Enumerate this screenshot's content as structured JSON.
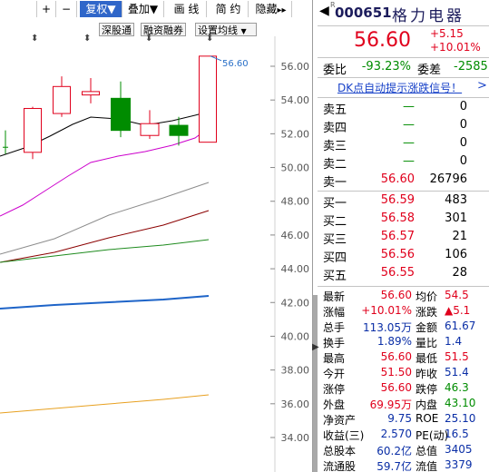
{
  "toolbar": {
    "plus": "+",
    "minus": "−",
    "fuquan": "复权",
    "fuquan_arrow": "▼",
    "diejia": "叠加",
    "diejia_arrow": "▼",
    "huaxian": "画 线",
    "jianyue": "简 约",
    "yincang": "隐藏",
    "more": "▸▸"
  },
  "sub_toolbar": {
    "shengutong": "深股通",
    "rongzirongquan": "融资融券",
    "set_ma": "设置均线",
    "set_ma_arrow": "▼"
  },
  "chart_data": {
    "type": "candlestick",
    "y_ticks": [
      "56.00",
      "54.00",
      "52.00",
      "50.00",
      "48.00",
      "46.00",
      "44.00",
      "42.00",
      "40.00",
      "38.00",
      "36.00",
      "34.00"
    ],
    "ylim": [
      33.5,
      57.5
    ],
    "price_label": "56.60",
    "candles": [
      {
        "open": 51.2,
        "close": 51.2,
        "high": 52.2,
        "low": 50.8,
        "color": "#008c00"
      },
      {
        "open": 50.9,
        "close": 53.5,
        "high": 53.6,
        "low": 50.5,
        "color": "#e0001c"
      },
      {
        "open": 53.2,
        "close": 54.8,
        "high": 55.4,
        "low": 53.0,
        "color": "#e0001c"
      },
      {
        "open": 54.3,
        "close": 54.5,
        "high": 55.3,
        "low": 53.8,
        "color": "#e0001c"
      },
      {
        "open": 54.1,
        "close": 52.2,
        "high": 55.1,
        "low": 51.8,
        "color": "#008c00"
      },
      {
        "open": 51.9,
        "close": 52.6,
        "high": 53.4,
        "low": 51.7,
        "color": "#e0001c"
      },
      {
        "open": 52.5,
        "close": 51.9,
        "high": 53.0,
        "low": 51.3,
        "color": "#008c00"
      },
      {
        "open": 51.5,
        "close": 56.6,
        "high": 56.6,
        "low": 51.5,
        "color": "#e0001c"
      }
    ]
  },
  "quote": {
    "code": "000651",
    "name": "格力电器",
    "price": "56.60",
    "change": "+5.15",
    "change_pct": "+10.01%",
    "weibi_label": "委比",
    "weibi_value": "-93.23%",
    "weicha_label": "委差",
    "weicha_value": "-2585",
    "dk_link": "DK点自动提示涨跌信号！",
    "dk_arrow": ">",
    "sell": [
      {
        "label": "卖五",
        "price": "—",
        "vol": "0"
      },
      {
        "label": "卖四",
        "price": "—",
        "vol": "0"
      },
      {
        "label": "卖三",
        "price": "—",
        "vol": "0"
      },
      {
        "label": "卖二",
        "price": "—",
        "vol": "0"
      },
      {
        "label": "卖一",
        "price": "56.60",
        "vol": "26796"
      }
    ],
    "buy": [
      {
        "label": "买一",
        "price": "56.59",
        "vol": "483"
      },
      {
        "label": "买二",
        "price": "56.58",
        "vol": "301"
      },
      {
        "label": "买三",
        "price": "56.57",
        "vol": "21"
      },
      {
        "label": "买四",
        "price": "56.56",
        "vol": "106"
      },
      {
        "label": "买五",
        "price": "56.55",
        "vol": "28"
      }
    ],
    "stats": [
      {
        "l1": "最新",
        "v1": "56.60",
        "c1": "red",
        "l2": "均价",
        "v2": "54.5",
        "c2": "red"
      },
      {
        "l1": "涨幅",
        "v1": "+10.01%",
        "c1": "red",
        "l2": "涨跌",
        "v2": "▲5.1",
        "c2": "red"
      },
      {
        "l1": "总手",
        "v1": "113.05万",
        "c1": "navy",
        "l2": "金额",
        "v2": "61.67",
        "c2": "navy"
      },
      {
        "l1": "换手",
        "v1": "1.89%",
        "c1": "navy",
        "l2": "量比",
        "v2": "1.4",
        "c2": "navy"
      },
      {
        "l1": "最高",
        "v1": "56.60",
        "c1": "red",
        "l2": "最低",
        "v2": "51.5",
        "c2": "red"
      },
      {
        "l1": "今开",
        "v1": "51.50",
        "c1": "red",
        "l2": "昨收",
        "v2": "51.4",
        "c2": "navy"
      },
      {
        "l1": "涨停",
        "v1": "56.60",
        "c1": "red",
        "l2": "跌停",
        "v2": "46.3",
        "c2": "green"
      },
      {
        "l1": "外盘",
        "v1": "69.95万",
        "c1": "red",
        "l2": "内盘",
        "v2": "43.10",
        "c2": "green"
      },
      {
        "l1": "净资产",
        "v1": "9.75",
        "c1": "navy",
        "l2": "ROE",
        "v2": "25.10",
        "c2": "navy"
      },
      {
        "l1": "收益(三)",
        "v1": "2.570",
        "c1": "navy",
        "l2": "PE(动)",
        "v2": "16.5",
        "c2": "navy"
      },
      {
        "l1": "总股本",
        "v1": "60.2亿",
        "c1": "navy",
        "l2": "总值",
        "v2": "3405",
        "c2": "navy"
      },
      {
        "l1": "流通股",
        "v1": "59.7亿",
        "c1": "navy",
        "l2": "流值",
        "v2": "3379",
        "c2": "navy"
      }
    ]
  }
}
